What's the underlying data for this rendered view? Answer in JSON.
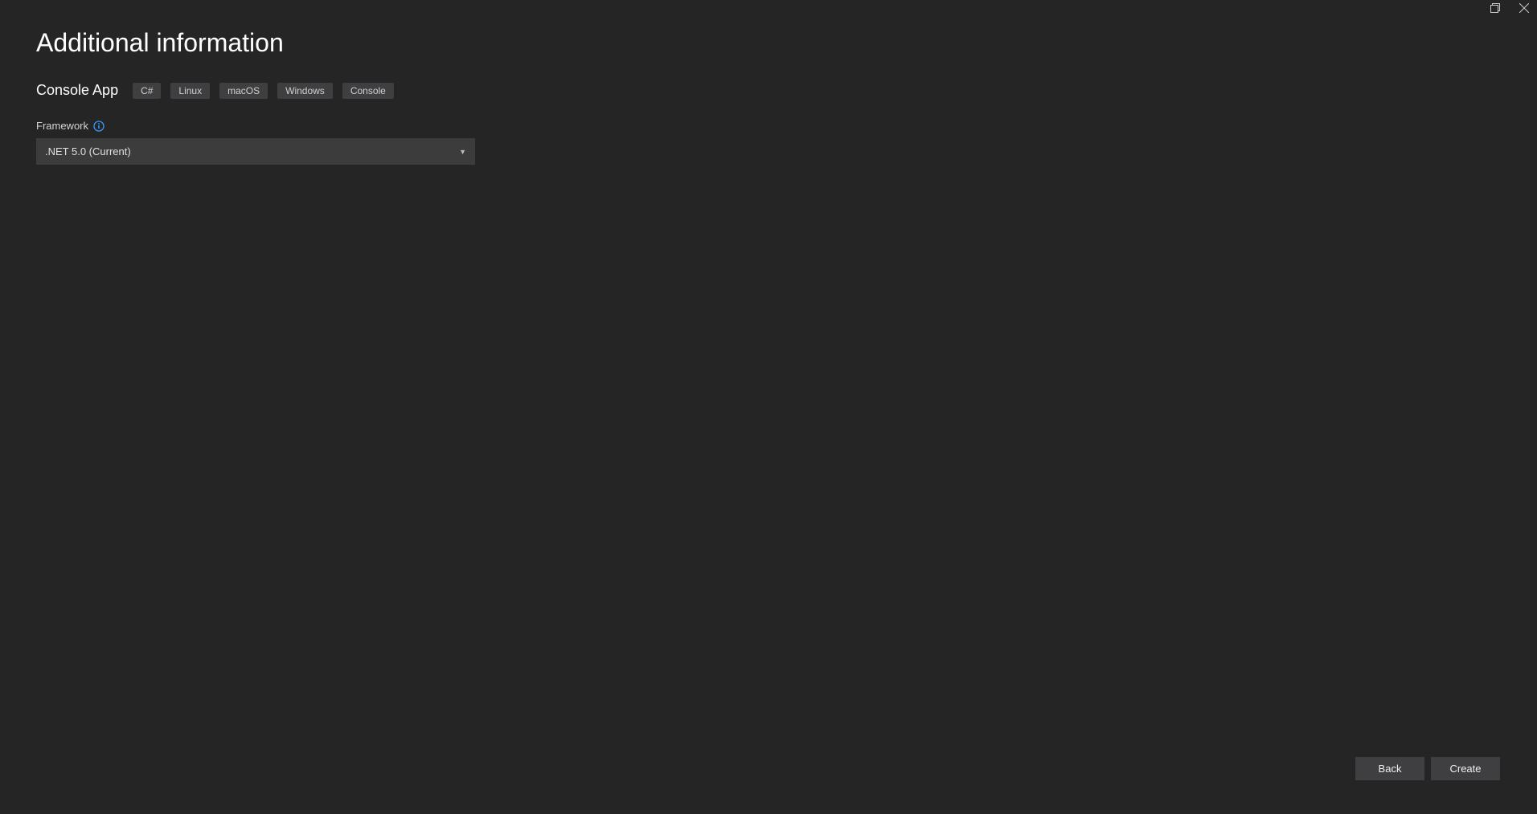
{
  "header": {
    "title": "Additional information"
  },
  "project": {
    "name": "Console App",
    "tags": [
      "C#",
      "Linux",
      "macOS",
      "Windows",
      "Console"
    ]
  },
  "form": {
    "framework": {
      "label": "Framework",
      "selected": ".NET 5.0 (Current)"
    }
  },
  "footer": {
    "back_label": "Back",
    "create_label": "Create"
  }
}
